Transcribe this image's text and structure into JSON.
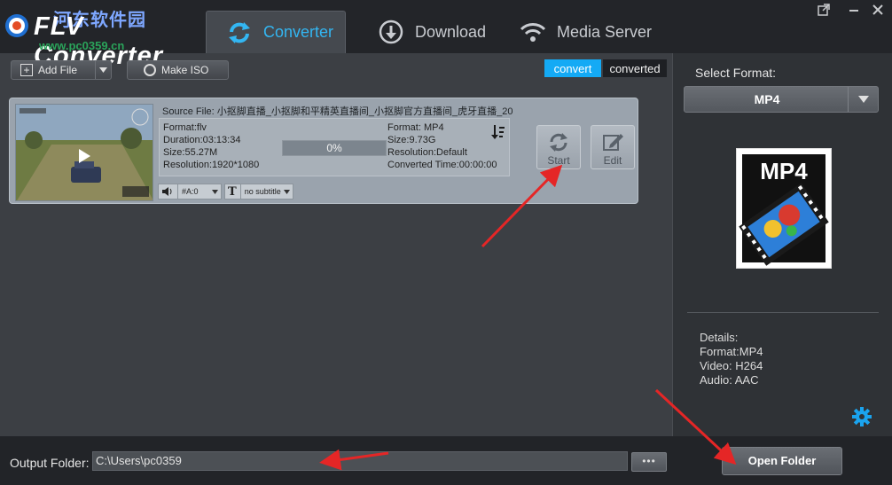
{
  "app": {
    "title": "FLV Converter",
    "watermark": "河东软件园",
    "watermark_url": "www.pc0359.cn"
  },
  "tabs": [
    {
      "label": "Converter",
      "icon": "refresh-icon",
      "active": true
    },
    {
      "label": "Download",
      "icon": "download-icon",
      "active": false
    },
    {
      "label": "Media Server",
      "icon": "wifi-icon",
      "active": false
    }
  ],
  "window": {
    "popout_icon": "popout-icon",
    "minimize_icon": "minimize-icon",
    "close_icon": "close-icon"
  },
  "toolbar": {
    "add_file_label": "Add File",
    "make_iso_label": "Make ISO"
  },
  "view_toggle": {
    "convert_label": "convert",
    "converted_label": "converted"
  },
  "file_item": {
    "source": "Source File: 小抠脚直播_小抠脚和平精英直播间_小抠脚官方直播间_虎牙直播_20",
    "input": {
      "format": "Format:flv",
      "duration": "Duration:03:13:34",
      "size": "Size:55.27M",
      "resolution": "Resolution:1920*1080"
    },
    "progress_text": "0%",
    "progress_value": 0,
    "output": {
      "format": "Format: MP4",
      "size": "Size:9.73G",
      "resolution": "Resolution:Default",
      "converted_time": "Converted Time:00:00:00"
    },
    "start_label": "Start",
    "edit_label": "Edit",
    "audio_track": "#A:0",
    "subtitle": "no subtitle"
  },
  "right_panel": {
    "select_format_label": "Select Format:",
    "selected_format": "MP4",
    "preview_text": "MP4",
    "details": [
      "Details:",
      "Format:MP4",
      "Video: H264",
      "Audio: AAC"
    ]
  },
  "bottom": {
    "output_folder_label": "Output Folder:",
    "output_folder_value": "C:\\Users\\pc0359",
    "browse_label": "•••",
    "open_folder_label": "Open Folder"
  },
  "colors": {
    "accent": "#14aaf5",
    "tab_active_text": "#33b6f2",
    "annotation_arrow": "#e52626"
  }
}
